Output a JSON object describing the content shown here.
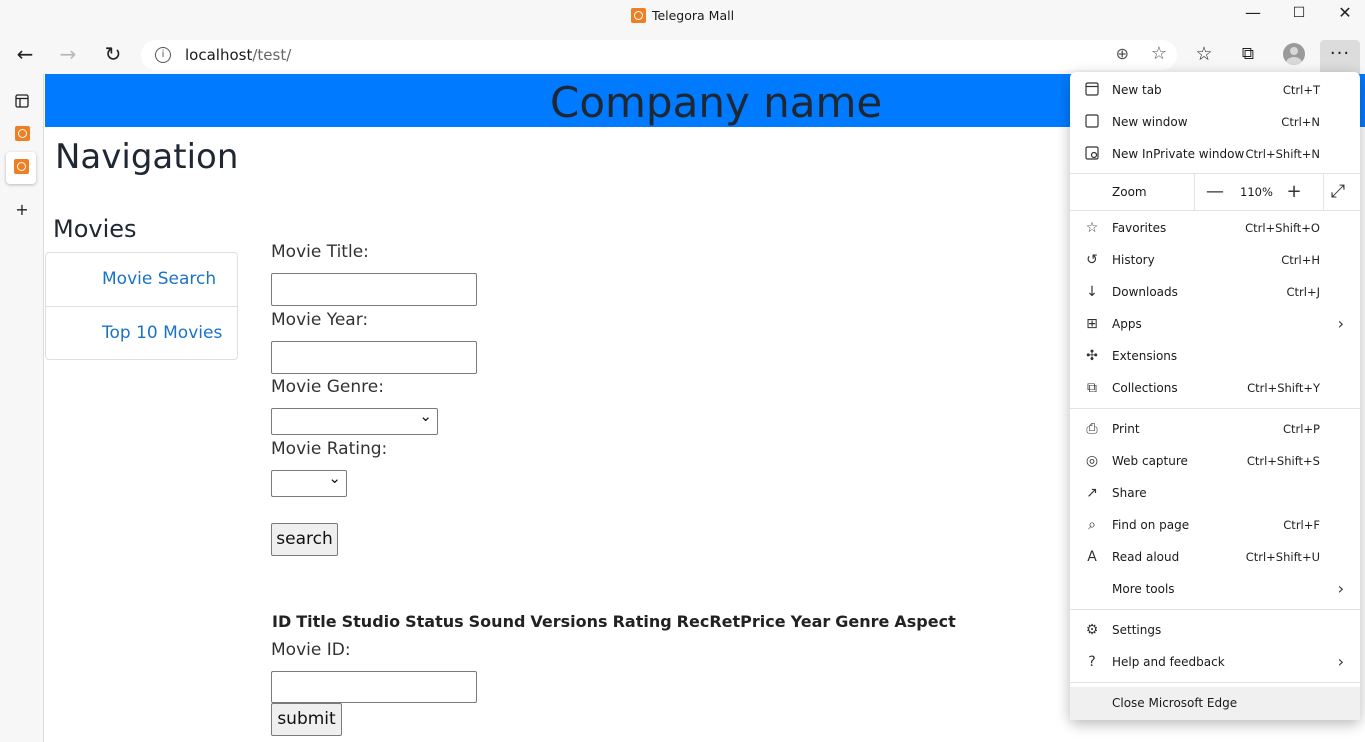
{
  "window": {
    "title": "Telegora Mall",
    "minimize": "—",
    "maximize": "☐",
    "close": "✕"
  },
  "toolbar": {
    "back": "←",
    "forward": "→",
    "refresh": "↻",
    "url_host": "localhost",
    "url_path": "/test/",
    "zoom_glyph": "⊕",
    "add_favorite_glyph": "☆",
    "favorites_glyph": "☆",
    "collections_glyph": "⧉",
    "menu_glyph": "···"
  },
  "sidebar_tabs": {
    "new_tab_glyph": "+"
  },
  "page": {
    "company_name": "Company name",
    "nav_heading": "Navigation",
    "movies_heading": "Movies",
    "nav_items": [
      "Movie Search",
      "Top 10 Movies"
    ],
    "form": {
      "title_label": "Movie Title:",
      "year_label": "Movie Year:",
      "genre_label": "Movie Genre:",
      "rating_label": "Movie Rating:",
      "search_button": "search",
      "movie_id_label": "Movie ID:",
      "submit_button": "submit"
    },
    "table_columns": [
      "ID",
      "Title",
      "Studio",
      "Status",
      "Sound",
      "Versions",
      "Rating",
      "RecRetPrice",
      "Year",
      "Genre",
      "Aspect"
    ]
  },
  "menu": {
    "new_tab": {
      "label": "New tab",
      "shortcut": "Ctrl+T",
      "icon": "new-tab-icon"
    },
    "new_window": {
      "label": "New window",
      "shortcut": "Ctrl+N",
      "icon": "new-window-icon"
    },
    "new_inprivate": {
      "label": "New InPrivate window",
      "shortcut": "Ctrl+Shift+N",
      "icon": "inprivate-icon"
    },
    "zoom": {
      "label": "Zoom",
      "value": "110%",
      "minus": "—",
      "plus": "+",
      "fullscreen": "⤢"
    },
    "favorites": {
      "label": "Favorites",
      "shortcut": "Ctrl+Shift+O",
      "icon": "favorites-icon"
    },
    "history": {
      "label": "History",
      "shortcut": "Ctrl+H",
      "icon": "history-icon"
    },
    "downloads": {
      "label": "Downloads",
      "shortcut": "Ctrl+J",
      "icon": "download-icon"
    },
    "apps": {
      "label": "Apps",
      "icon": "apps-icon"
    },
    "extensions": {
      "label": "Extensions",
      "icon": "extensions-icon"
    },
    "collections": {
      "label": "Collections",
      "shortcut": "Ctrl+Shift+Y",
      "icon": "collections-icon"
    },
    "print": {
      "label": "Print",
      "shortcut": "Ctrl+P",
      "icon": "print-icon"
    },
    "web_capture": {
      "label": "Web capture",
      "shortcut": "Ctrl+Shift+S",
      "icon": "web-capture-icon"
    },
    "share": {
      "label": "Share",
      "icon": "share-icon"
    },
    "find": {
      "label": "Find on page",
      "shortcut": "Ctrl+F",
      "icon": "find-icon"
    },
    "read_aloud": {
      "label": "Read aloud",
      "shortcut": "Ctrl+Shift+U",
      "icon": "read-aloud-icon"
    },
    "more_tools": {
      "label": "More tools"
    },
    "settings": {
      "label": "Settings",
      "icon": "gear-icon"
    },
    "help": {
      "label": "Help and feedback",
      "icon": "help-icon"
    },
    "close_edge": {
      "label": "Close Microsoft Edge"
    },
    "chevron": "›"
  },
  "colors": {
    "banner": "#007bff",
    "link": "#1a73c8",
    "favicon": "#f07f24"
  }
}
